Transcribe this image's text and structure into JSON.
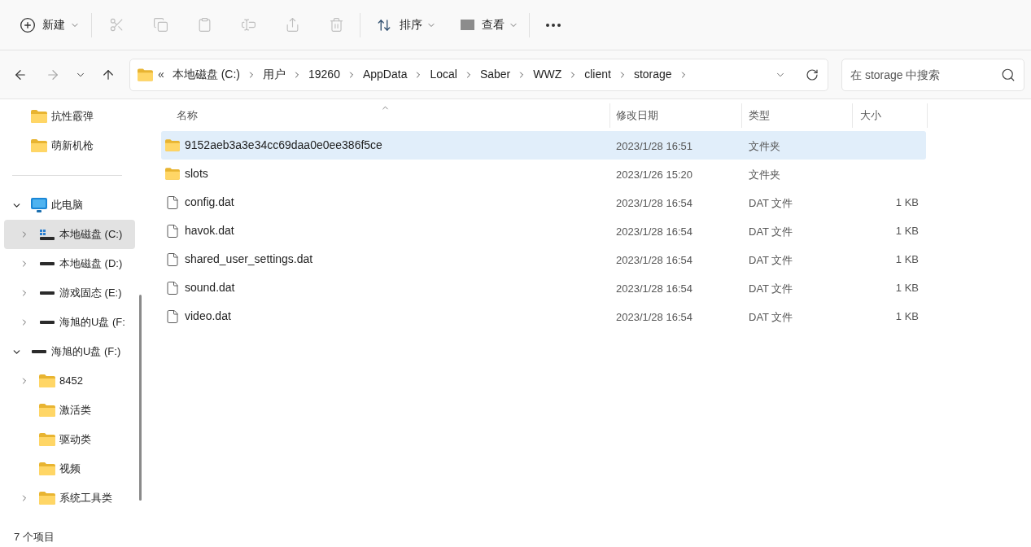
{
  "toolbar": {
    "new": {
      "label": "新建"
    },
    "actions": [
      {
        "kind": "cut",
        "disabled": true
      },
      {
        "kind": "copy",
        "disabled": true
      },
      {
        "kind": "paste",
        "disabled": true
      },
      {
        "kind": "rename",
        "disabled": true
      },
      {
        "kind": "share",
        "disabled": true
      },
      {
        "kind": "delete",
        "disabled": true
      }
    ],
    "sort": {
      "label": "排序"
    },
    "view": {
      "label": "查看"
    }
  },
  "navigation": [
    {
      "kind": "back",
      "disabled": false
    },
    {
      "kind": "forward",
      "disabled": true
    },
    {
      "kind": "recent",
      "disabled": false
    },
    {
      "kind": "up",
      "disabled": false
    }
  ],
  "address_bar": {
    "overflow": "«",
    "breadcrumbs": [
      "本地磁盘 (C:)",
      "用户",
      "19260",
      "AppData",
      "Local",
      "Saber",
      "WWZ",
      "client",
      "storage"
    ]
  },
  "search": {
    "placeholder": "在 storage 中搜索"
  },
  "sidebar": {
    "quick_access": [
      {
        "label": "抗性霰弹",
        "kind": "folder",
        "expandable": false,
        "expanded": false,
        "selected": false
      },
      {
        "label": "萌新机枪",
        "kind": "folder",
        "expandable": false,
        "expanded": false,
        "selected": false
      }
    ],
    "tree": [
      {
        "label": "此电脑",
        "kind": "pc",
        "expandable": true,
        "expanded": true,
        "selected": false,
        "children": [
          {
            "label": "本地磁盘 (C:)",
            "kind": "system_drive",
            "expandable": true,
            "expanded": false,
            "selected": true
          },
          {
            "label": "本地磁盘 (D:)",
            "kind": "drive",
            "expandable": true,
            "expanded": false,
            "selected": false
          },
          {
            "label": "游戏固态 (E:)",
            "kind": "drive",
            "expandable": true,
            "expanded": false,
            "selected": false
          },
          {
            "label": "海旭的U盘 (F:",
            "kind": "drive",
            "expandable": true,
            "expanded": false,
            "selected": false
          }
        ]
      },
      {
        "label": "海旭的U盘 (F:)",
        "kind": "drive",
        "expandable": true,
        "expanded": true,
        "selected": false,
        "children": [
          {
            "label": "8452",
            "kind": "folder",
            "expandable": true,
            "expanded": false,
            "selected": false
          },
          {
            "label": "激活类",
            "kind": "folder",
            "expandable": false,
            "expanded": false,
            "selected": false
          },
          {
            "label": "驱动类",
            "kind": "folder",
            "expandable": false,
            "expanded": false,
            "selected": false
          },
          {
            "label": "视频",
            "kind": "folder",
            "expandable": false,
            "expanded": false,
            "selected": false
          },
          {
            "label": "系统工具类",
            "kind": "folder",
            "expandable": true,
            "expanded": false,
            "selected": false
          }
        ]
      }
    ]
  },
  "file_list": {
    "columns": [
      {
        "label": "名称",
        "sorted": true
      },
      {
        "label": "修改日期",
        "sorted": false
      },
      {
        "label": "类型",
        "sorted": false
      },
      {
        "label": "大小",
        "sorted": false
      }
    ],
    "rows": [
      {
        "kind": "folder",
        "name": "9152aeb3a3e34cc69daa0e0ee386f5ce",
        "modified": "2023/1/28 16:51",
        "type": "文件夹",
        "selected": true
      },
      {
        "kind": "folder",
        "name": "slots",
        "modified": "2023/1/26 15:20",
        "type": "文件夹",
        "selected": false
      },
      {
        "kind": "file",
        "name": "config.dat",
        "modified": "2023/1/28 16:54",
        "type": "DAT 文件",
        "size": "1 KB",
        "selected": false
      },
      {
        "kind": "file",
        "name": "havok.dat",
        "modified": "2023/1/28 16:54",
        "type": "DAT 文件",
        "size": "1 KB",
        "selected": false
      },
      {
        "kind": "file",
        "name": "shared_user_settings.dat",
        "modified": "2023/1/28 16:54",
        "type": "DAT 文件",
        "size": "1 KB",
        "selected": false
      },
      {
        "kind": "file",
        "name": "sound.dat",
        "modified": "2023/1/28 16:54",
        "type": "DAT 文件",
        "size": "1 KB",
        "selected": false
      },
      {
        "kind": "file",
        "name": "video.dat",
        "modified": "2023/1/28 16:54",
        "type": "DAT 文件",
        "size": "1 KB",
        "selected": false
      }
    ]
  },
  "status_bar": {
    "item_count": "7 个项目"
  }
}
